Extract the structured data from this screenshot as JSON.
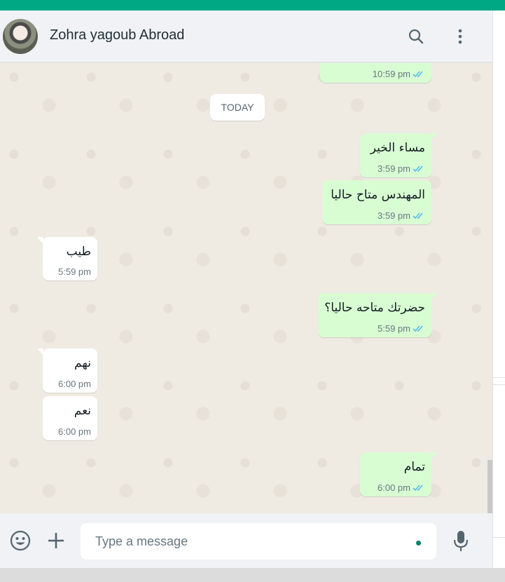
{
  "header": {
    "contact_name": "Zohra yagoub Abroad",
    "avatar_icon": "contact-avatar",
    "search_icon": "search-icon",
    "menu_icon": "more-vert-icon"
  },
  "chat": {
    "day_separator": "TODAY",
    "messages": [
      {
        "direction": "out",
        "text": "",
        "time": "10:59 pm",
        "status": "read"
      },
      {
        "direction": "out",
        "text": "مساء الخير",
        "time": "3:59 pm",
        "status": "read"
      },
      {
        "direction": "out",
        "text": "المهندس متاح حاليا",
        "time": "3:59 pm",
        "status": "read"
      },
      {
        "direction": "in",
        "text": "طيب",
        "time": "5:59 pm"
      },
      {
        "direction": "out",
        "text": "حضرتك متاحه حاليا؟",
        "time": "5:59 pm",
        "status": "read"
      },
      {
        "direction": "in",
        "text": "نهم",
        "time": "6:00 pm"
      },
      {
        "direction": "in",
        "text": "نعم",
        "time": "6:00 pm"
      },
      {
        "direction": "out",
        "text": "تمام",
        "time": "6:00 pm",
        "status": "read"
      }
    ]
  },
  "footer": {
    "emoji_icon": "emoji-icon",
    "attach_icon": "plus-icon",
    "message_placeholder": "Type a message",
    "mic_icon": "mic-icon"
  },
  "colors": {
    "accent": "#00a884",
    "outgoing_bubble": "#d9fdd3",
    "incoming_bubble": "#ffffff",
    "chat_background": "#efeae2",
    "read_ticks": "#53bdeb"
  }
}
